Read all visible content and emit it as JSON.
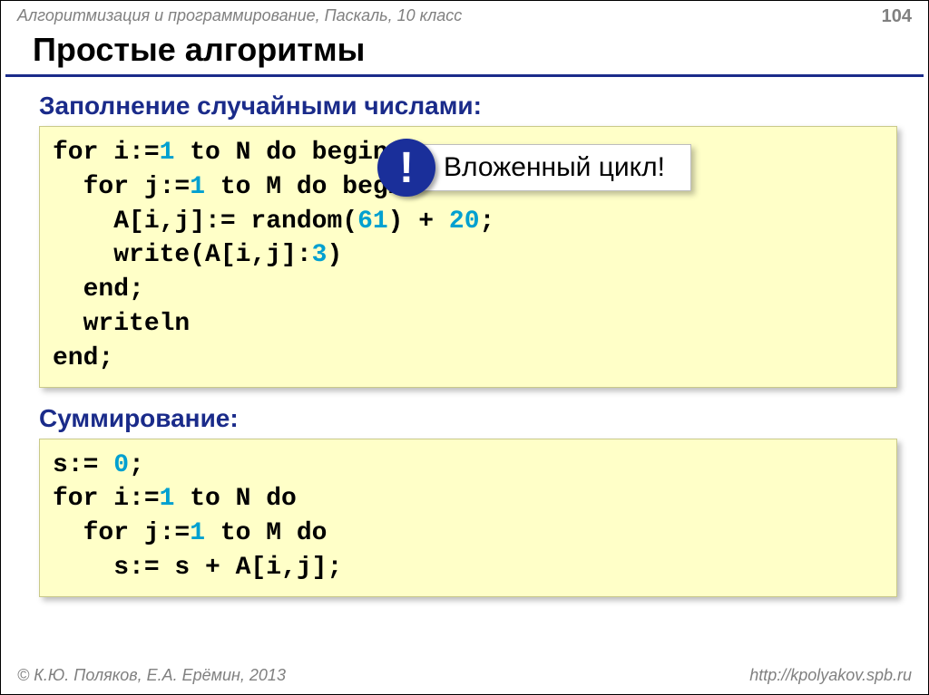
{
  "header": {
    "course": "Алгоритмизация и программирование, Паскаль, 10 класс",
    "page": "104"
  },
  "title": "Простые алгоритмы",
  "section1": "Заполнение случайными числами:",
  "code1": {
    "l1a": "for i:=",
    "l1n": "1",
    "l1b": " to N do begin",
    "l2a": "  for j:=",
    "l2n": "1",
    "l2b": " to M do begin",
    "l3a": "    A[i,j]:= random(",
    "l3n1": "61",
    "l3b": ") + ",
    "l3n2": "20",
    "l3c": ";",
    "l4a": "    write(A[i,j]:",
    "l4n": "3",
    "l4b": ")",
    "l5": "  end;",
    "l6": "  writeln",
    "l7": "end;"
  },
  "callout": {
    "mark": "!",
    "text": "Вложенный цикл!"
  },
  "section2": "Суммирование:",
  "code2": {
    "l1a": "s:= ",
    "l1n": "0",
    "l1b": ";",
    "l2a": "for i:=",
    "l2n": "1",
    "l2b": " to N do",
    "l3a": "  for j:=",
    "l3n": "1",
    "l3b": " to M do",
    "l4": "    s:= s + A[i,j];"
  },
  "footer": {
    "copyright": "© К.Ю. Поляков, Е.А. Ерёмин, 2013",
    "url": "http://kpolyakov.spb.ru"
  }
}
